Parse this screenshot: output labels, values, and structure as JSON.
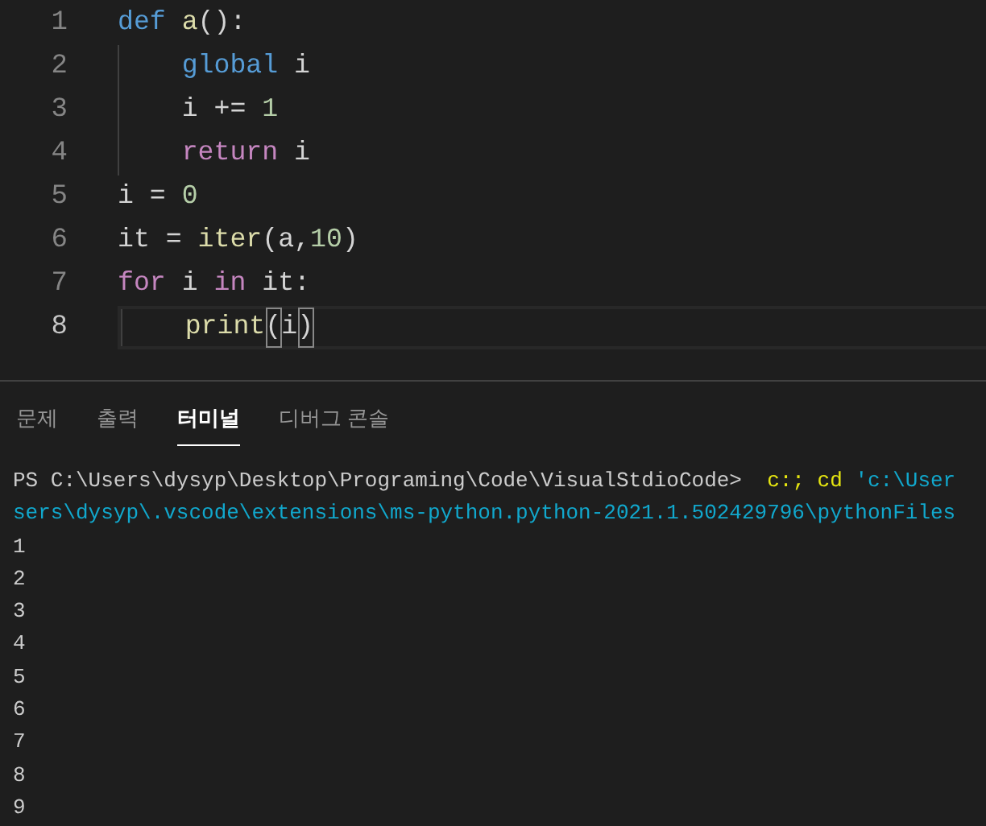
{
  "editor": {
    "lines": [
      {
        "number": "1",
        "current": false,
        "tokens": [
          {
            "text": "def",
            "kind": "keyword"
          },
          {
            "text": " a",
            "kind": "function"
          },
          {
            "text": "():",
            "kind": "plain"
          }
        ]
      },
      {
        "number": "2",
        "current": false,
        "tokens": [
          {
            "text": "    global",
            "kind": "keyword"
          },
          {
            "text": " i",
            "kind": "plain"
          }
        ]
      },
      {
        "number": "3",
        "current": false,
        "tokens": [
          {
            "text": "    i += ",
            "kind": "plain"
          },
          {
            "text": "1",
            "kind": "number"
          }
        ]
      },
      {
        "number": "4",
        "current": false,
        "tokens": [
          {
            "text": "    return",
            "kind": "control"
          },
          {
            "text": " i",
            "kind": "plain"
          }
        ]
      },
      {
        "number": "5",
        "current": false,
        "tokens": [
          {
            "text": "i = ",
            "kind": "plain"
          },
          {
            "text": "0",
            "kind": "number"
          }
        ]
      },
      {
        "number": "6",
        "current": false,
        "tokens": [
          {
            "text": "it = ",
            "kind": "plain"
          },
          {
            "text": "iter",
            "kind": "function"
          },
          {
            "text": "(a,",
            "kind": "plain"
          },
          {
            "text": "10",
            "kind": "number"
          },
          {
            "text": ")",
            "kind": "plain"
          }
        ]
      },
      {
        "number": "7",
        "current": false,
        "tokens": [
          {
            "text": "for",
            "kind": "control"
          },
          {
            "text": " i ",
            "kind": "plain"
          },
          {
            "text": "in",
            "kind": "control"
          },
          {
            "text": " it:",
            "kind": "plain"
          }
        ]
      },
      {
        "number": "8",
        "current": true,
        "tokens": [
          {
            "text": "    print",
            "kind": "function"
          },
          {
            "text": "(",
            "kind": "bracket_match"
          },
          {
            "text": "i",
            "kind": "plain"
          },
          {
            "text": ")",
            "kind": "bracket_match"
          }
        ]
      }
    ]
  },
  "panel": {
    "tabs": [
      {
        "label": "문제",
        "selected": false
      },
      {
        "label": "출력",
        "selected": false
      },
      {
        "label": "터미널",
        "selected": true
      },
      {
        "label": "디버그 콘솔",
        "selected": false
      }
    ],
    "terminal": {
      "lines": [
        [
          {
            "text": "PS C:\\Users\\dysyp\\Desktop\\Programing\\Code\\VisualStdioCode>  ",
            "kind": "plain"
          },
          {
            "text": "c:; cd",
            "kind": "command"
          },
          {
            "text": " 'c:\\User",
            "kind": "string"
          }
        ],
        [
          {
            "text": "sers\\dysyp\\.vscode\\extensions\\ms-python.python-2021.1.502429796\\pythonFiles",
            "kind": "string"
          }
        ],
        [
          {
            "text": "1",
            "kind": "plain"
          }
        ],
        [
          {
            "text": "2",
            "kind": "plain"
          }
        ],
        [
          {
            "text": "3",
            "kind": "plain"
          }
        ],
        [
          {
            "text": "4",
            "kind": "plain"
          }
        ],
        [
          {
            "text": "5",
            "kind": "plain"
          }
        ],
        [
          {
            "text": "6",
            "kind": "plain"
          }
        ],
        [
          {
            "text": "7",
            "kind": "plain"
          }
        ],
        [
          {
            "text": "8",
            "kind": "plain"
          }
        ],
        [
          {
            "text": "9",
            "kind": "plain"
          }
        ]
      ]
    }
  }
}
